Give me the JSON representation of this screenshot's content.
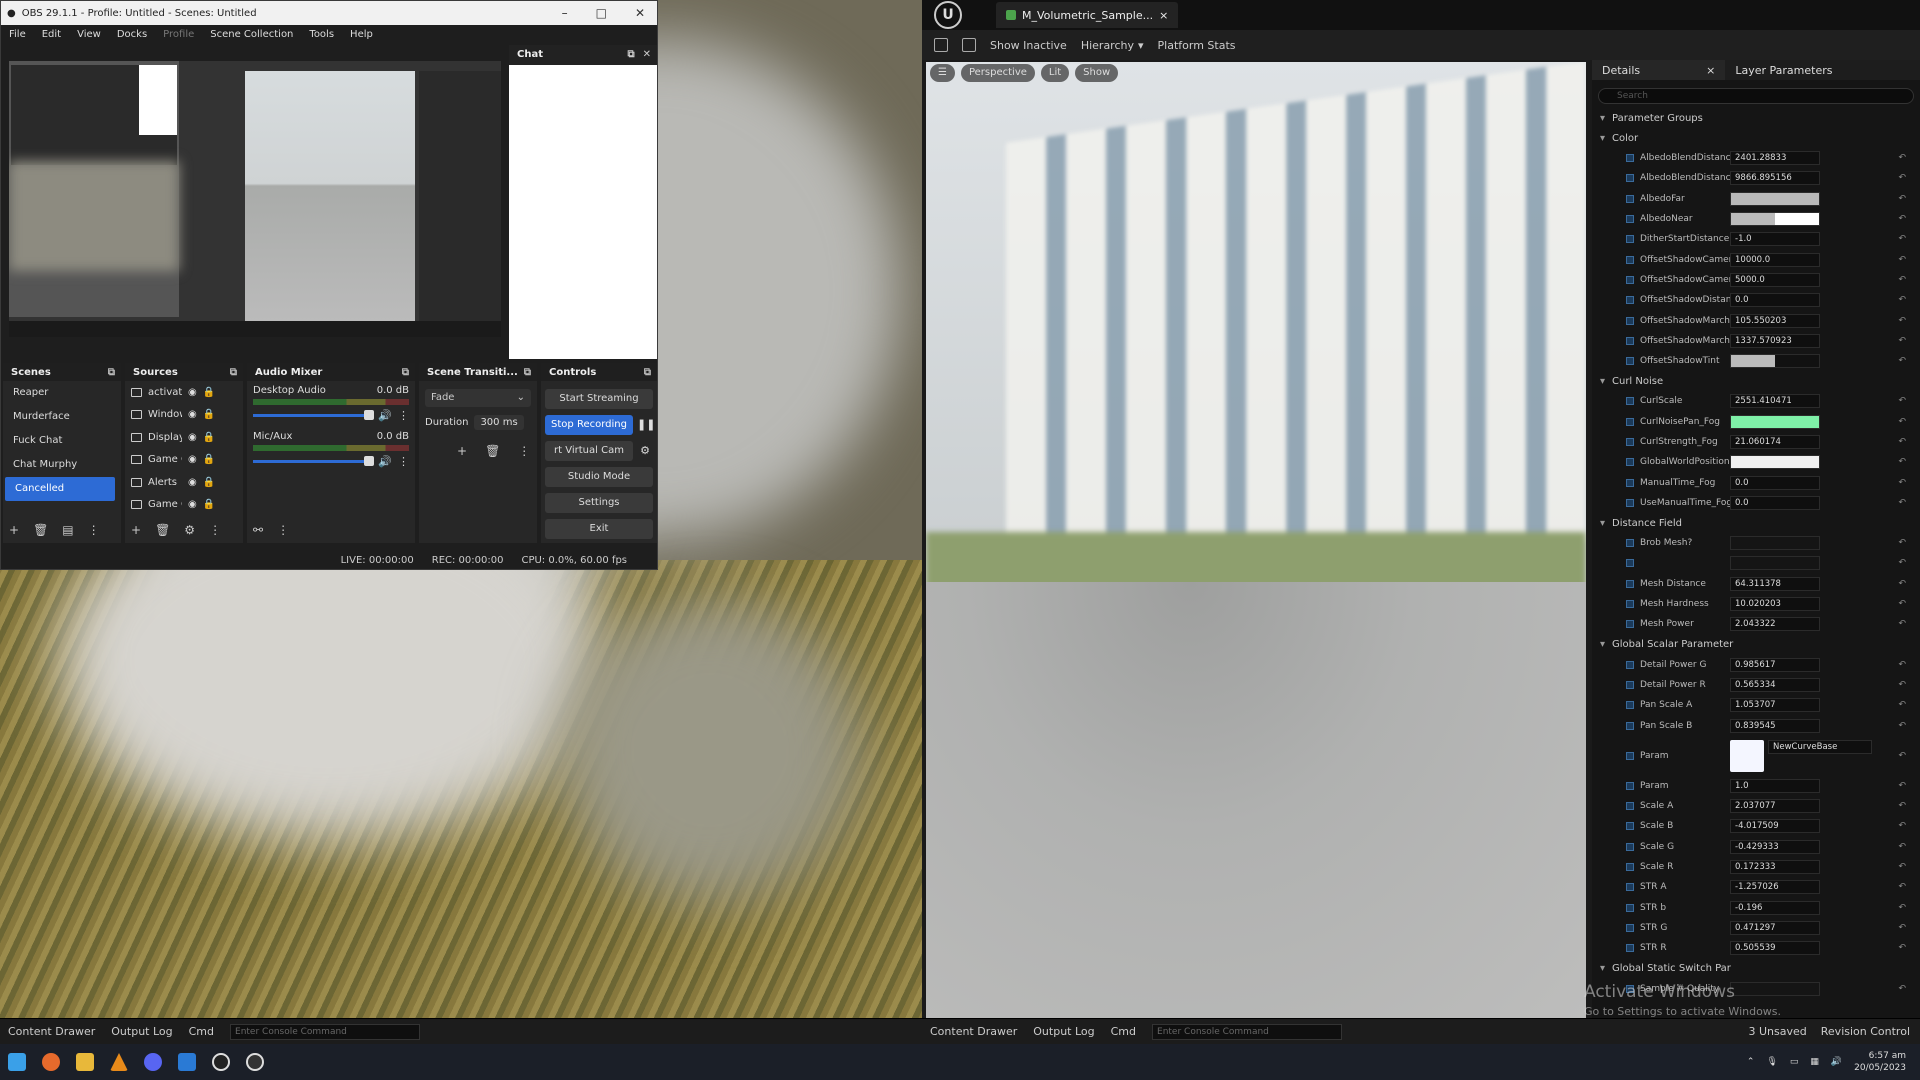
{
  "obs": {
    "title": "OBS 29.1.1 - Profile: Untitled - Scenes: Untitled",
    "menu": [
      "File",
      "Edit",
      "View",
      "Docks",
      "Profile",
      "Scene Collection",
      "Tools",
      "Help"
    ],
    "chat_title": "Chat",
    "docks": {
      "scenes": "Scenes",
      "sources": "Sources",
      "audio": "Audio Mixer",
      "transitions": "Scene Transiti...",
      "controls": "Controls"
    },
    "scenes": [
      "Reaper",
      "Murderface",
      "Fuck Chat",
      "Chat Murphy",
      "Cancelled"
    ],
    "sources": [
      "activati",
      "Window",
      "Display",
      "Game C",
      "Alerts",
      "Game C"
    ],
    "audio": [
      {
        "name": "Desktop Audio",
        "db": "0.0 dB"
      },
      {
        "name": "Mic/Aux",
        "db": "0.0 dB"
      }
    ],
    "transition": {
      "type": "Fade",
      "duration_label": "Duration",
      "duration_value": "300 ms"
    },
    "controls": {
      "start_streaming": "Start Streaming",
      "stop_recording": "Stop Recording",
      "virtual_cam": "rt Virtual Cam",
      "studio_mode": "Studio Mode",
      "settings": "Settings",
      "exit": "Exit"
    },
    "status": {
      "live": "LIVE: 00:00:00",
      "rec": "REC: 00:00:00",
      "cpu": "CPU: 0.0%, 60.00 fps"
    }
  },
  "left_editor_bar": {
    "content_drawer": "Content Drawer",
    "output_log": "Output Log",
    "cmd": "Cmd",
    "console_placeholder": "Enter Console Command"
  },
  "ue": {
    "tab": "M_Volumetric_Sample...",
    "toolbar": {
      "show_inactive": "Show Inactive",
      "hierarchy": "Hierarchy",
      "platform_stats": "Platform Stats"
    },
    "viewport": {
      "perspective": "Perspective",
      "lit": "Lit",
      "show": "Show"
    },
    "details_tab": "Details",
    "layer_tab": "Layer Parameters",
    "search_placeholder": "Search",
    "param_groups": "Parameter Groups",
    "groups": [
      {
        "name": "Color",
        "rows": [
          {
            "label": "AlbedoBlendDistanc...",
            "value": "2401.28833"
          },
          {
            "label": "AlbedoBlendDistanc...",
            "value": "9866.895156"
          },
          {
            "label": "AlbedoFar",
            "value": ""
          },
          {
            "label": "AlbedoNear",
            "value": ""
          },
          {
            "label": "DitherStartDistance",
            "value": "-1.0"
          },
          {
            "label": "OffsetShadowCamer...",
            "value": "10000.0"
          },
          {
            "label": "OffsetShadowCamer...",
            "value": "5000.0"
          },
          {
            "label": "OffsetShadowDistan...",
            "value": "0.0"
          },
          {
            "label": "OffsetShadowMarch...",
            "value": "105.550203"
          },
          {
            "label": "OffsetShadowMarch...",
            "value": "1337.570923"
          },
          {
            "label": "OffsetShadowTint",
            "value": ""
          }
        ]
      },
      {
        "name": "Curl Noise",
        "rows": [
          {
            "label": "CurlScale",
            "value": "2551.410471"
          },
          {
            "label": "CurlNoisePan_Fog",
            "value": ""
          },
          {
            "label": "CurlStrength_Fog",
            "value": "21.060174"
          },
          {
            "label": "GlobalWorldPosition",
            "value": ""
          },
          {
            "label": "ManualTime_Fog",
            "value": "0.0"
          },
          {
            "label": "UseManualTime_Fog",
            "value": "0.0"
          }
        ]
      },
      {
        "name": "Distance Field",
        "rows": [
          {
            "label": "Brob Mesh?",
            "value": ""
          },
          {
            "label": "",
            "value": ""
          },
          {
            "label": "Mesh Distance",
            "value": "64.311378"
          },
          {
            "label": "Mesh Hardness",
            "value": "10.020203"
          },
          {
            "label": "Mesh Power",
            "value": "2.043322"
          }
        ]
      },
      {
        "name": "Global Scalar Parameter",
        "rows": [
          {
            "label": "Detail Power G",
            "value": "0.985617"
          },
          {
            "label": "Detail Power R",
            "value": "0.565334"
          },
          {
            "label": "Pan Scale A",
            "value": "1.053707"
          },
          {
            "label": "Pan Scale B",
            "value": "0.839545"
          },
          {
            "label": "Param",
            "value": "NewCurveBase"
          },
          {
            "label": "Param",
            "value": "1.0"
          },
          {
            "label": "Scale A",
            "value": "2.037077"
          },
          {
            "label": "Scale B",
            "value": "-4.017509"
          },
          {
            "label": "Scale G",
            "value": "-0.429333"
          },
          {
            "label": "Scale R",
            "value": "0.172333"
          },
          {
            "label": "STR A",
            "value": "-1.257026"
          },
          {
            "label": "STR b",
            "value": "-0.196"
          },
          {
            "label": "STR G",
            "value": "0.471297"
          },
          {
            "label": "STR R",
            "value": "0.505539"
          }
        ]
      },
      {
        "name": "Global Static Switch Par",
        "rows": [
          {
            "label": "Sample # Quality",
            "value": ""
          }
        ]
      }
    ],
    "bottom": {
      "content_drawer": "Content Drawer",
      "output_log": "Output Log",
      "cmd": "Cmd",
      "console_placeholder": "Enter Console Command",
      "unsaved": "3 Unsaved",
      "revision": "Revision Control"
    }
  },
  "watermark": {
    "line1": "Activate Windows",
    "line2": "Go to Settings to activate Windows."
  },
  "taskbar": {
    "time": "6:57 am",
    "date": "20/05/2023"
  }
}
